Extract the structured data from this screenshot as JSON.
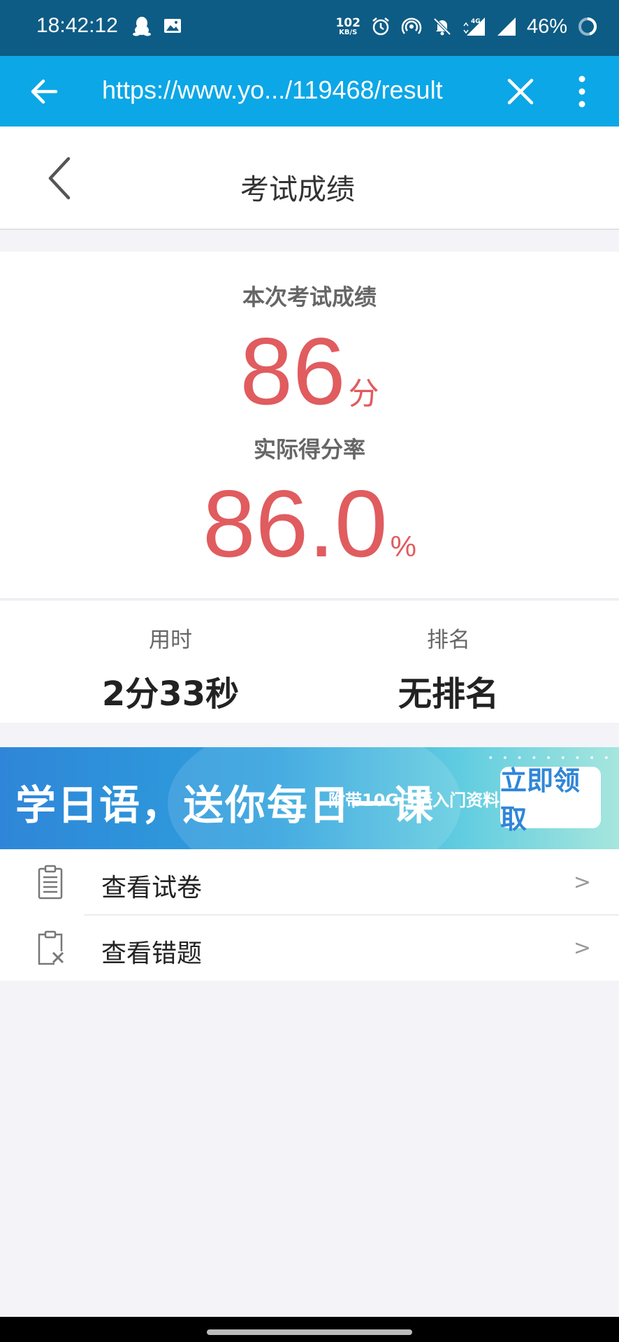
{
  "status_bar": {
    "time": "18:42:12",
    "left_icons": [
      "qq-icon",
      "image-icon"
    ],
    "speed_value": "102",
    "speed_unit": "KB/S",
    "right_icons": [
      "alarm-icon",
      "hotspot-icon",
      "mute-icon",
      "signal-4g-icon",
      "signal-icon",
      "battery-icon"
    ],
    "battery": "46%"
  },
  "browser_bar": {
    "url": "https://www.yo.../119468/result"
  },
  "page_header": {
    "title": "考试成绩"
  },
  "score": {
    "label": "本次考试成绩",
    "value": "86",
    "unit": "分",
    "rate_label": "实际得分率",
    "rate_value": "86.0",
    "rate_unit": "%"
  },
  "stats": {
    "time_label": "用时",
    "time_value": "2分33秒",
    "rank_label": "排名",
    "rank_value": "无排名"
  },
  "banner": {
    "main_text": "学日语，送你每日一课",
    "sub_text": "附带10G日语入门资料包",
    "button_label": "立即领取"
  },
  "list": {
    "items": [
      {
        "label": "查看试卷",
        "chevron": ">"
      },
      {
        "label": "查看错题",
        "chevron": ">"
      }
    ]
  },
  "colors": {
    "status_bar_bg": "#0d5c85",
    "browser_bar_bg": "#0ca7e6",
    "score_red": "#e05c5f"
  }
}
